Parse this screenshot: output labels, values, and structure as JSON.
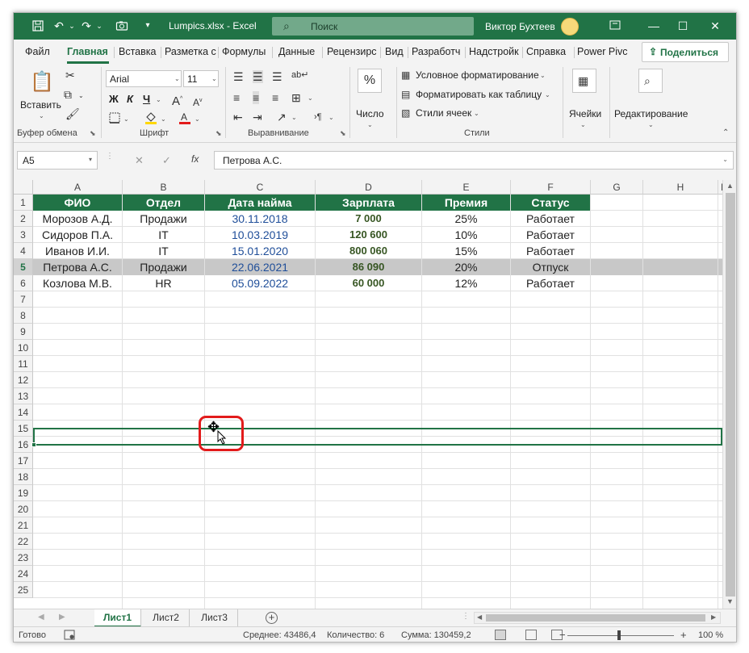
{
  "titlebar": {
    "doc_title": "Lumpics.xlsx  -  Excel",
    "search_placeholder": "Поиск",
    "user_name": "Виктор Бухтеев",
    "colors": {
      "accent": "#217346"
    }
  },
  "tabs": {
    "items": [
      "Файл",
      "Главная",
      "Вставка",
      "Разметка с",
      "Формулы",
      "Данные",
      "Рецензирс",
      "Вид",
      "Разработч",
      "Надстройк",
      "Справка",
      "Power Pivc"
    ],
    "active": "Главная",
    "share_label": "Поделиться"
  },
  "ribbon": {
    "clipboard": {
      "paste_label": "Вставить",
      "group_label": "Буфер обмена"
    },
    "font": {
      "font_name": "Arial",
      "font_size": "11",
      "bold": "Ж",
      "italic": "К",
      "underline": "Ч",
      "group_label": "Шрифт"
    },
    "alignment": {
      "group_label": "Выравнивание"
    },
    "number": {
      "format_label": "Число",
      "percent_symbol": "%"
    },
    "styles": {
      "conditional": "Условное форматирование",
      "as_table": "Форматировать как таблицу",
      "cell_styles": "Стили ячеек",
      "group_label": "Стили"
    },
    "cells": {
      "label": "Ячейки"
    },
    "editing": {
      "label": "Редактирование"
    }
  },
  "formula_bar": {
    "name_box": "A5",
    "fx": "fx",
    "content": "Петрова А.С."
  },
  "grid": {
    "columns": [
      "A",
      "B",
      "C",
      "D",
      "E",
      "F",
      "G",
      "H",
      "I"
    ],
    "rows": [
      "1",
      "2",
      "3",
      "4",
      "5",
      "6",
      "7",
      "8",
      "9",
      "10",
      "11",
      "12",
      "13",
      "14",
      "15",
      "16",
      "17",
      "18",
      "19",
      "20",
      "21",
      "22",
      "23",
      "24",
      "25"
    ],
    "selected_row": "5",
    "headers": [
      "ФИО",
      "Отдел",
      "Дата найма",
      "Зарплата",
      "Премия",
      "Статус"
    ],
    "data": [
      [
        "Морозов А.Д.",
        "Продажи",
        "30.11.2018",
        "7 000",
        "25%",
        "Работает"
      ],
      [
        "Сидоров П.А.",
        "IT",
        "10.03.2019",
        "120 600",
        "10%",
        "Работает"
      ],
      [
        "Иванов И.И.",
        "IT",
        "15.01.2020",
        "800 060",
        "15%",
        "Работает"
      ],
      [
        "Петрова А.С.",
        "Продажи",
        "22.06.2021",
        "86 090",
        "20%",
        "Отпуск"
      ],
      [
        "Козлова М.В.",
        "HR",
        "05.09.2022",
        "60 000",
        "12%",
        "Работает"
      ]
    ]
  },
  "sheets": {
    "tabs": [
      "Лист1",
      "Лист2",
      "Лист3"
    ],
    "active": "Лист1"
  },
  "status": {
    "ready": "Готово",
    "average": "Среднее: 43486,4",
    "count": "Количество: 6",
    "sum": "Сумма: 130459,2",
    "zoom": "100 %",
    "zoom_minus": "−",
    "zoom_plus": "+"
  }
}
